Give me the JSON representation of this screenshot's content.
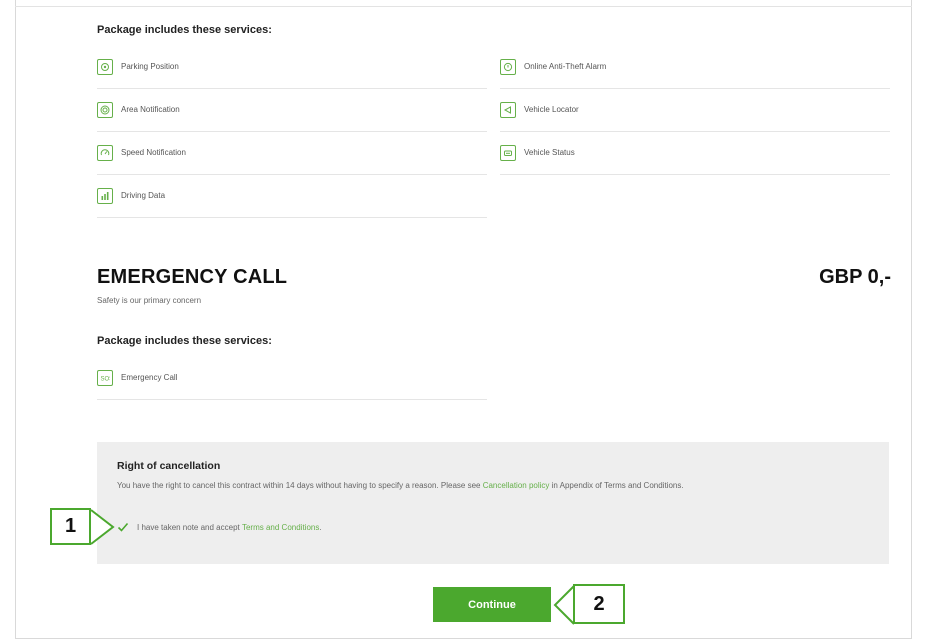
{
  "section1": {
    "heading": "Package includes these services:",
    "services_left": [
      {
        "label": "Parking Position",
        "icon": "parking-position-icon"
      },
      {
        "label": "Area Notification",
        "icon": "area-notification-icon"
      },
      {
        "label": "Speed Notification",
        "icon": "speed-notification-icon"
      },
      {
        "label": "Driving Data",
        "icon": "driving-data-icon"
      }
    ],
    "services_right": [
      {
        "label": "Online Anti-Theft Alarm",
        "icon": "anti-theft-alarm-icon"
      },
      {
        "label": "Vehicle Locator",
        "icon": "vehicle-locator-icon"
      },
      {
        "label": "Vehicle Status",
        "icon": "vehicle-status-icon"
      }
    ]
  },
  "emergency": {
    "title": "EMERGENCY CALL",
    "price": "GBP 0,-",
    "tagline": "Safety is our primary concern",
    "heading": "Package includes these services:",
    "services": [
      {
        "label": "Emergency Call",
        "icon": "emergency-call-icon"
      }
    ]
  },
  "cancellation": {
    "title": "Right of cancellation",
    "text_before": "You have the right to cancel this contract within 14 days without having to specify a reason. Please see ",
    "policy_link": "Cancellation policy",
    "text_after": " in Appendix of Terms and Conditions.",
    "accept_text": "I have taken note and accept ",
    "terms_link": "Terms and Conditions",
    "accept_end": ".",
    "checked": true
  },
  "continue_label": "Continue",
  "callouts": [
    "1",
    "2"
  ],
  "colors": {
    "accent": "#4ba82e",
    "link": "#66b04a"
  }
}
